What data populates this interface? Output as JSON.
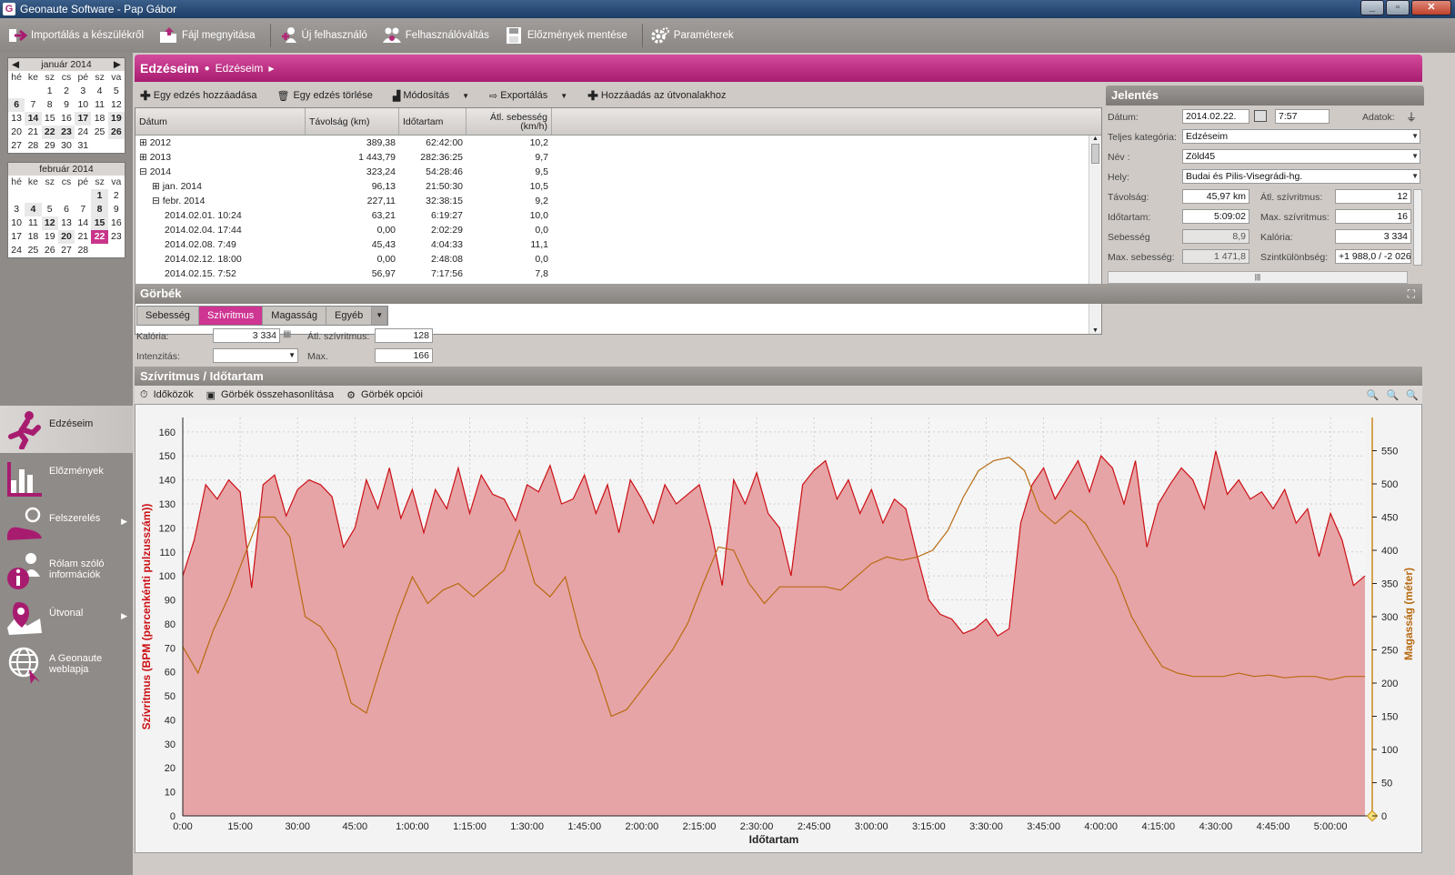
{
  "window": {
    "title": "Geonaute Software - Pap Gábor"
  },
  "toolbar": {
    "import": "Importálás a készülékről",
    "open_file": "Fájl megnyitása",
    "new_user": "Új felhasználó",
    "switch_user": "Felhasználóváltás",
    "save_history": "Előzmények mentése",
    "settings": "Paraméterek"
  },
  "calendar_jan": {
    "title": "január 2014",
    "days": [
      "hé",
      "ke",
      "sz",
      "cs",
      "pé",
      "sz",
      "va"
    ],
    "cells": [
      "",
      "",
      "1",
      "2",
      "3",
      "4",
      "5",
      "6",
      "7",
      "8",
      "9",
      "10",
      "11",
      "12",
      "13",
      "14",
      "15",
      "16",
      "17",
      "18",
      "19",
      "20",
      "21",
      "22",
      "23",
      "24",
      "25",
      "26",
      "27",
      "28",
      "29",
      "30",
      "31",
      "",
      "",
      "",
      ""
    ],
    "bold": [
      "6",
      "14",
      "17",
      "19",
      "22",
      "23",
      "26"
    ]
  },
  "calendar_feb": {
    "title": "február 2014",
    "days": [
      "hé",
      "ke",
      "sz",
      "cs",
      "pé",
      "sz",
      "va"
    ],
    "cells": [
      "",
      "",
      "",
      "",
      "",
      "1",
      "2",
      "3",
      "4",
      "5",
      "6",
      "7",
      "8",
      "9",
      "10",
      "11",
      "12",
      "13",
      "14",
      "15",
      "16",
      "17",
      "18",
      "19",
      "20",
      "21",
      "22",
      "23",
      "24",
      "25",
      "26",
      "27",
      "28",
      "",
      ""
    ],
    "bold": [
      "1",
      "4",
      "8",
      "12",
      "15",
      "20"
    ],
    "selected": "22"
  },
  "nav": {
    "workouts": "Edzéseim",
    "history": "Előzmények",
    "equipment": "Felszerelés",
    "about_me": "Rólam szóló információk",
    "route": "Útvonal",
    "website": "A Geonaute weblapja"
  },
  "breadcrumb": {
    "title": "Edzéseim",
    "sub": "Edzéseim"
  },
  "workout_toolbar": {
    "add": "Egy edzés hozzáadása",
    "delete": "Egy edzés törlése",
    "modify": "Módosítás",
    "export": "Exportálás",
    "add_route": "Hozzáadás az útvonalakhoz"
  },
  "table": {
    "headers": [
      "Dátum",
      "Távolság (km)",
      "Időtartam",
      "Átl. sebesség (km/h)"
    ],
    "rows": [
      {
        "exp": "⊞",
        "indent": 0,
        "date": "2012",
        "dist": "389,38",
        "dur": "62:42:00",
        "speed": "10,2"
      },
      {
        "exp": "⊞",
        "indent": 0,
        "date": "2013",
        "dist": "1 443,79",
        "dur": "282:36:25",
        "speed": "9,7"
      },
      {
        "exp": "⊟",
        "indent": 0,
        "date": "2014",
        "dist": "323,24",
        "dur": "54:28:46",
        "speed": "9,5"
      },
      {
        "exp": "⊞",
        "indent": 1,
        "date": "jan. 2014",
        "dist": "96,13",
        "dur": "21:50:30",
        "speed": "10,5"
      },
      {
        "exp": "⊟",
        "indent": 1,
        "date": "febr. 2014",
        "dist": "227,11",
        "dur": "32:38:15",
        "speed": "9,2"
      },
      {
        "exp": "",
        "indent": 2,
        "date": "2014.02.01. 10:24",
        "dist": "63,21",
        "dur": "6:19:27",
        "speed": "10,0"
      },
      {
        "exp": "",
        "indent": 2,
        "date": "2014.02.04. 17:44",
        "dist": "0,00",
        "dur": "2:02:29",
        "speed": "0,0"
      },
      {
        "exp": "",
        "indent": 2,
        "date": "2014.02.08. 7:49",
        "dist": "45,43",
        "dur": "4:04:33",
        "speed": "11,1"
      },
      {
        "exp": "",
        "indent": 2,
        "date": "2014.02.12. 18:00",
        "dist": "0,00",
        "dur": "2:48:08",
        "speed": "0,0"
      },
      {
        "exp": "",
        "indent": 2,
        "date": "2014.02.15. 7:52",
        "dist": "56,97",
        "dur": "7:17:56",
        "speed": "7,8"
      }
    ]
  },
  "report": {
    "title": "Jelentés",
    "date_label": "Dátum:",
    "date": "2014.02.22.",
    "time": "7:57",
    "data_label": "Adatok:",
    "category_label": "Teljes kategória:",
    "category": "Edzéseim",
    "name_label": "Név :",
    "name": "Zöld45",
    "place_label": "Hely:",
    "place": "Budai és Pilis-Visegrádi-hg.",
    "distance_label": "Távolság:",
    "distance": "45,97 km",
    "avg_hr_label": "Átl. szívritmus:",
    "avg_hr": "12",
    "duration_label": "Időtartam:",
    "duration": "5:09:02",
    "max_hr_label": "Max. szívritmus:",
    "max_hr": "16",
    "speed_label": "Sebesség",
    "speed": "8,9",
    "calories_label": "Kalória:",
    "calories": "3 334",
    "max_speed_label": "Max. sebesség:",
    "max_speed": "1 471,8",
    "elev_label": "Szintkülönbség:",
    "elev": "+1 988,0 / -2 026"
  },
  "curves": {
    "title": "Görbék",
    "tabs": [
      "Sebesség",
      "Szívritmus",
      "Magasság",
      "Egyéb"
    ],
    "active_tab": 1,
    "calories_label": "Kalória:",
    "calories": "3 334",
    "avg_hr_label": "Átl. szívritmus:",
    "avg_hr": "128",
    "intensity_label": "Intenzitás:",
    "max_label": "Max.",
    "max": "166"
  },
  "chart_panel": {
    "title": "Szívritmus / Időtartam",
    "intervals": "Időközök",
    "compare": "Görbék összehasonlítása",
    "options": "Görbék opciói"
  },
  "chart_data": {
    "type": "area",
    "xlabel": "Időtartam",
    "ylabel": "Szívritmus (BPM (percenkénti pulzusszám))",
    "y2label": "Magasság (méter)",
    "x_ticks": [
      "0:00",
      "15:00",
      "30:00",
      "45:00",
      "1:00:00",
      "1:15:00",
      "1:30:00",
      "1:45:00",
      "2:00:00",
      "2:15:00",
      "2:30:00",
      "2:45:00",
      "3:00:00",
      "3:15:00",
      "3:30:00",
      "3:45:00",
      "4:00:00",
      "4:15:00",
      "4:30:00",
      "4:45:00",
      "5:00:00"
    ],
    "xlim_minutes": [
      0,
      309
    ],
    "ylim": [
      0,
      166
    ],
    "y_ticks": [
      0,
      10,
      20,
      30,
      40,
      50,
      60,
      70,
      80,
      90,
      100,
      110,
      120,
      130,
      140,
      150,
      160
    ],
    "y2lim": [
      0,
      600
    ],
    "y2_ticks": [
      0,
      50,
      100,
      150,
      200,
      250,
      300,
      350,
      400,
      450,
      500,
      550
    ],
    "grid": true,
    "colors": {
      "hr_fill": "#e6a4a6",
      "hr_line": "#cc0f14",
      "alt_line": "#b86a10",
      "alt_axis": "#c98a1a"
    },
    "series": [
      {
        "name": "Szívritmus",
        "x_minutes": [
          0,
          3,
          6,
          9,
          12,
          15,
          18,
          21,
          24,
          27,
          30,
          33,
          36,
          39,
          42,
          45,
          48,
          51,
          54,
          57,
          60,
          63,
          66,
          69,
          72,
          75,
          78,
          81,
          84,
          87,
          90,
          93,
          96,
          99,
          102,
          105,
          108,
          111,
          114,
          117,
          120,
          123,
          126,
          129,
          132,
          135,
          138,
          141,
          144,
          147,
          150,
          153,
          156,
          159,
          162,
          165,
          168,
          171,
          174,
          177,
          180,
          183,
          186,
          189,
          192,
          195,
          198,
          201,
          204,
          207,
          210,
          213,
          216,
          219,
          222,
          225,
          228,
          231,
          234,
          237,
          240,
          243,
          246,
          249,
          252,
          255,
          258,
          261,
          264,
          267,
          270,
          273,
          276,
          279,
          282,
          285,
          288,
          291,
          294,
          297,
          300,
          303,
          306,
          309
        ],
        "values": [
          100,
          115,
          138,
          132,
          140,
          135,
          95,
          138,
          142,
          125,
          136,
          140,
          138,
          133,
          112,
          120,
          140,
          128,
          145,
          124,
          136,
          118,
          136,
          128,
          145,
          126,
          142,
          134,
          132,
          123,
          138,
          135,
          146,
          130,
          132,
          142,
          126,
          138,
          118,
          140,
          132,
          122,
          138,
          130,
          134,
          138,
          120,
          96,
          140,
          130,
          143,
          126,
          120,
          100,
          138,
          144,
          148,
          132,
          140,
          126,
          136,
          122,
          132,
          128,
          108,
          90,
          84,
          82,
          76,
          78,
          82,
          75,
          78,
          122,
          138,
          145,
          132,
          140,
          148,
          135,
          150,
          145,
          130,
          148,
          112,
          130,
          138,
          145,
          140,
          128,
          152,
          134,
          140,
          132,
          135,
          128,
          136,
          122,
          128,
          108,
          126,
          115,
          96,
          100
        ]
      },
      {
        "name": "Magasság",
        "x_minutes": [
          0,
          4,
          8,
          12,
          16,
          20,
          24,
          28,
          32,
          36,
          40,
          44,
          48,
          52,
          56,
          60,
          64,
          68,
          72,
          76,
          80,
          84,
          88,
          92,
          96,
          100,
          104,
          108,
          112,
          116,
          120,
          124,
          128,
          132,
          136,
          140,
          144,
          148,
          152,
          156,
          160,
          164,
          168,
          172,
          176,
          180,
          184,
          188,
          192,
          196,
          200,
          204,
          208,
          212,
          216,
          220,
          224,
          228,
          232,
          236,
          240,
          244,
          248,
          252,
          256,
          260,
          264,
          268,
          272,
          276,
          280,
          284,
          288,
          292,
          296,
          300,
          304,
          309
        ],
        "values": [
          255,
          215,
          280,
          330,
          390,
          450,
          450,
          420,
          300,
          285,
          250,
          170,
          155,
          230,
          300,
          360,
          320,
          340,
          350,
          330,
          350,
          370,
          430,
          350,
          330,
          360,
          270,
          220,
          150,
          160,
          190,
          220,
          250,
          290,
          350,
          405,
          400,
          350,
          320,
          345,
          345,
          345,
          345,
          340,
          360,
          380,
          390,
          385,
          390,
          400,
          430,
          480,
          520,
          535,
          540,
          520,
          460,
          440,
          460,
          440,
          400,
          360,
          300,
          260,
          225,
          215,
          210,
          210,
          210,
          215,
          210,
          212,
          208,
          210,
          210,
          205,
          210,
          210
        ]
      }
    ]
  }
}
